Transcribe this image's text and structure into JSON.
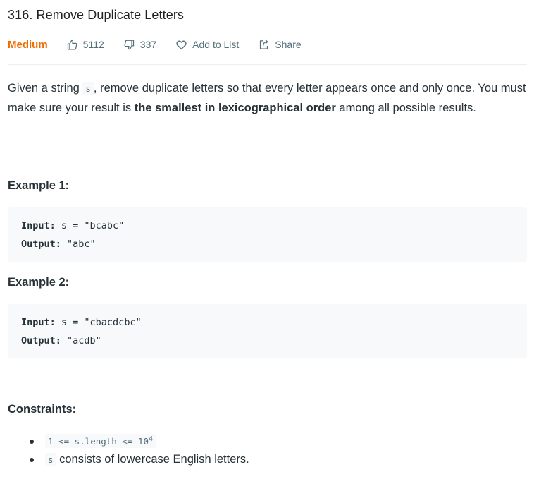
{
  "problem": {
    "title": "316. Remove Duplicate Letters",
    "difficulty": "Medium",
    "likes": "5112",
    "dislikes": "337",
    "add_to_list_label": "Add to List",
    "share_label": "Share"
  },
  "description": {
    "part1": "Given a string ",
    "var_s": "s",
    "part2": ", remove duplicate letters so that every letter appears once and only once. You must make sure your result is ",
    "bold": "the smallest in lexicographical order",
    "part3": " among all possible results."
  },
  "examples": [
    {
      "heading": "Example 1:",
      "input_label": "Input:",
      "input_value": " s = \"bcabc\"",
      "output_label": "Output:",
      "output_value": " \"abc\""
    },
    {
      "heading": "Example 2:",
      "input_label": "Input:",
      "input_value": " s = \"cbacdcbc\"",
      "output_label": "Output:",
      "output_value": " \"acdb\""
    }
  ],
  "constraints": {
    "heading": "Constraints:",
    "c1_code": "1 <= s.length <= 10",
    "c1_exp": "4",
    "c2_code": "s",
    "c2_text": " consists of lowercase English letters."
  },
  "colors": {
    "difficulty": "#ef6c00",
    "meta_text": "#546e7a",
    "code_bg": "#f7f9fa"
  },
  "icons": [
    "thumbs-up-icon",
    "thumbs-down-icon",
    "heart-icon",
    "share-icon"
  ]
}
